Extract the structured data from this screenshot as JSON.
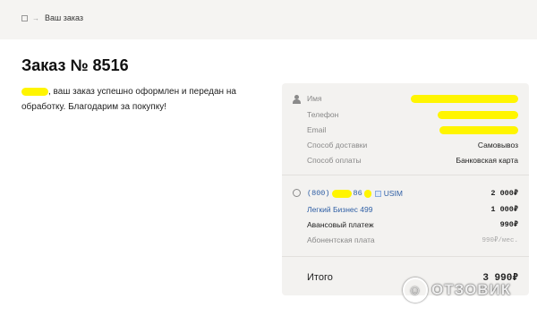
{
  "breadcrumb": {
    "current": "Ваш заказ",
    "separator": "→"
  },
  "page_title": "Заказ № 8516",
  "message": ", ваш заказ успешно оформлен и передан на обработку. Благодарим за покупку!",
  "order_info": {
    "name_label": "Имя",
    "phone_label": "Телефон",
    "email_label": "Email",
    "delivery_label": "Способ доставки",
    "delivery_value": "Самовывоз",
    "payment_label": "Способ оплаты",
    "payment_value": "Банковская карта"
  },
  "items": {
    "number_start": "(800)",
    "number_part": "86",
    "sim_label": "USIM",
    "number_price": "2 000₽",
    "tariff_name": "Легкий Бизнес 499",
    "tariff_price": "1 000₽",
    "advance_label": "Авансовый платеж",
    "advance_price": "990₽",
    "subscription_label": "Абонентская плата",
    "subscription_price": "990₽/мес."
  },
  "total": {
    "label": "Итого",
    "value": "3 990₽"
  },
  "watermark": "ОТЗОВИК",
  "colors": {
    "accent_link": "#2f5fa5",
    "redaction": "#fff500",
    "card_bg": "#f3f2f0",
    "topbar_bg": "#f5f4f2"
  }
}
